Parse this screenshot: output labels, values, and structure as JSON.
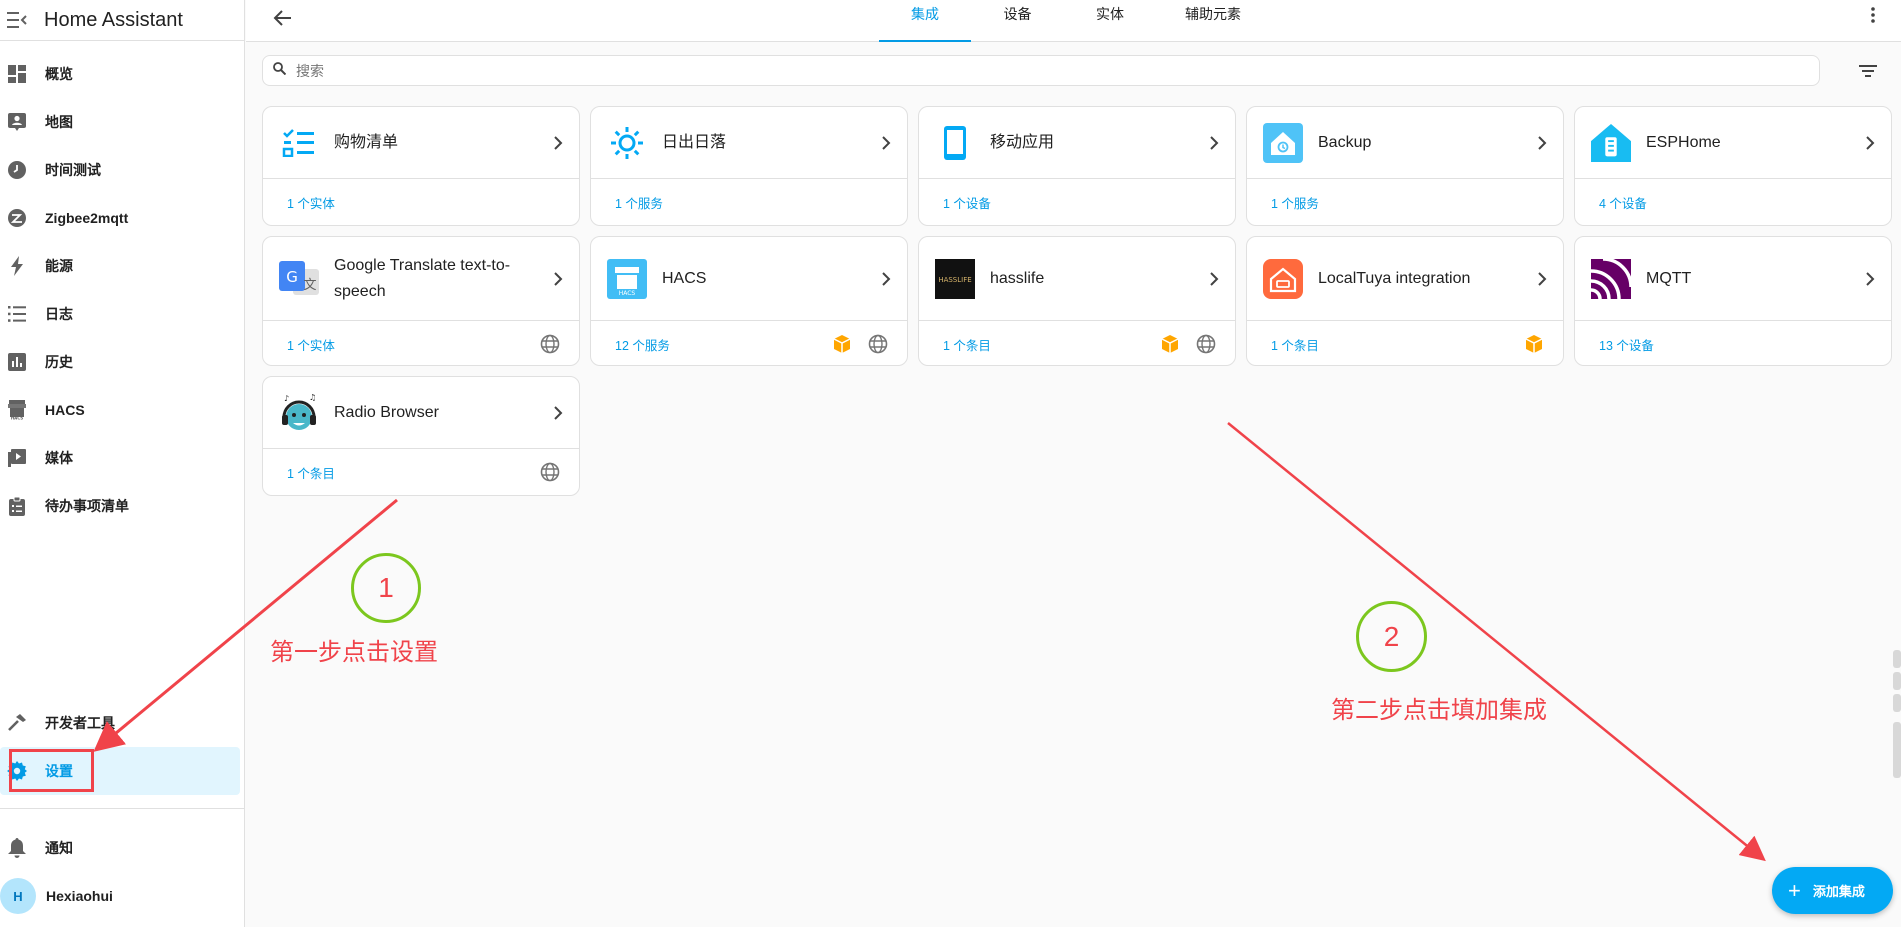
{
  "app": {
    "title": "Home Assistant"
  },
  "sidebar": {
    "items": [
      {
        "label": "概览",
        "icon": "dashboard-icon"
      },
      {
        "label": "地图",
        "icon": "map-account-icon"
      },
      {
        "label": "时间测试",
        "icon": "clock-icon"
      },
      {
        "label": "Zigbee2mqtt",
        "icon": "zigbee-icon"
      },
      {
        "label": "能源",
        "icon": "lightning-bolt-icon"
      },
      {
        "label": "日志",
        "icon": "list-icon"
      },
      {
        "label": "历史",
        "icon": "chart-box-icon"
      },
      {
        "label": "HACS",
        "icon": "hacs-icon"
      },
      {
        "label": "媒体",
        "icon": "play-box-icon"
      },
      {
        "label": "待办事项清单",
        "icon": "clipboard-list-icon"
      }
    ],
    "bottom_items": [
      {
        "label": "开发者工具",
        "icon": "hammer-icon"
      },
      {
        "label": "设置",
        "icon": "cog-icon",
        "active": true
      }
    ],
    "notifications_label": "通知",
    "user": {
      "initial": "H",
      "name": "Hexiaohui"
    }
  },
  "tabs": [
    {
      "label": "集成",
      "active": true
    },
    {
      "label": "设备"
    },
    {
      "label": "实体"
    },
    {
      "label": "辅助元素"
    }
  ],
  "search": {
    "placeholder": "搜索"
  },
  "cards": [
    {
      "name": "购物清单",
      "meta": "1 个实体",
      "icon": "shopping-list-icon"
    },
    {
      "name": "日出日落",
      "meta": "1 个服务",
      "icon": "sun-icon"
    },
    {
      "name": "移动应用",
      "meta": "1 个设备",
      "icon": "cellphone-icon"
    },
    {
      "name": "Backup",
      "meta": "1 个服务",
      "icon": "backup-icon"
    },
    {
      "name": "ESPHome",
      "meta": "4 个设备",
      "icon": "esphome-icon"
    },
    {
      "name": "Google Translate text-to-speech",
      "meta": "1 个实体",
      "icon": "google-translate-icon"
    },
    {
      "name": "HACS",
      "meta": "12 个服务",
      "icon": "hacs-logo-icon"
    },
    {
      "name": "hasslife",
      "meta": "1 个条目",
      "icon": "hasslife-icon"
    },
    {
      "name": "LocalTuya integration",
      "meta": "1 个条目",
      "icon": "localtuya-icon"
    },
    {
      "name": "MQTT",
      "meta": "13 个设备",
      "icon": "mqtt-icon"
    },
    {
      "name": "Radio Browser",
      "meta": "1 个条目",
      "icon": "radio-browser-icon"
    }
  ],
  "annotations": [
    {
      "number": "1",
      "text": "第一步点击设置"
    },
    {
      "number": "2",
      "text": "第二步点击填加集成"
    }
  ],
  "fab": {
    "label": "添加集成"
  },
  "colors": {
    "accent": "#039be5",
    "annotation_red": "#f0434a",
    "annotation_green": "#7cc71e",
    "custom_badge": "#ffa600"
  }
}
